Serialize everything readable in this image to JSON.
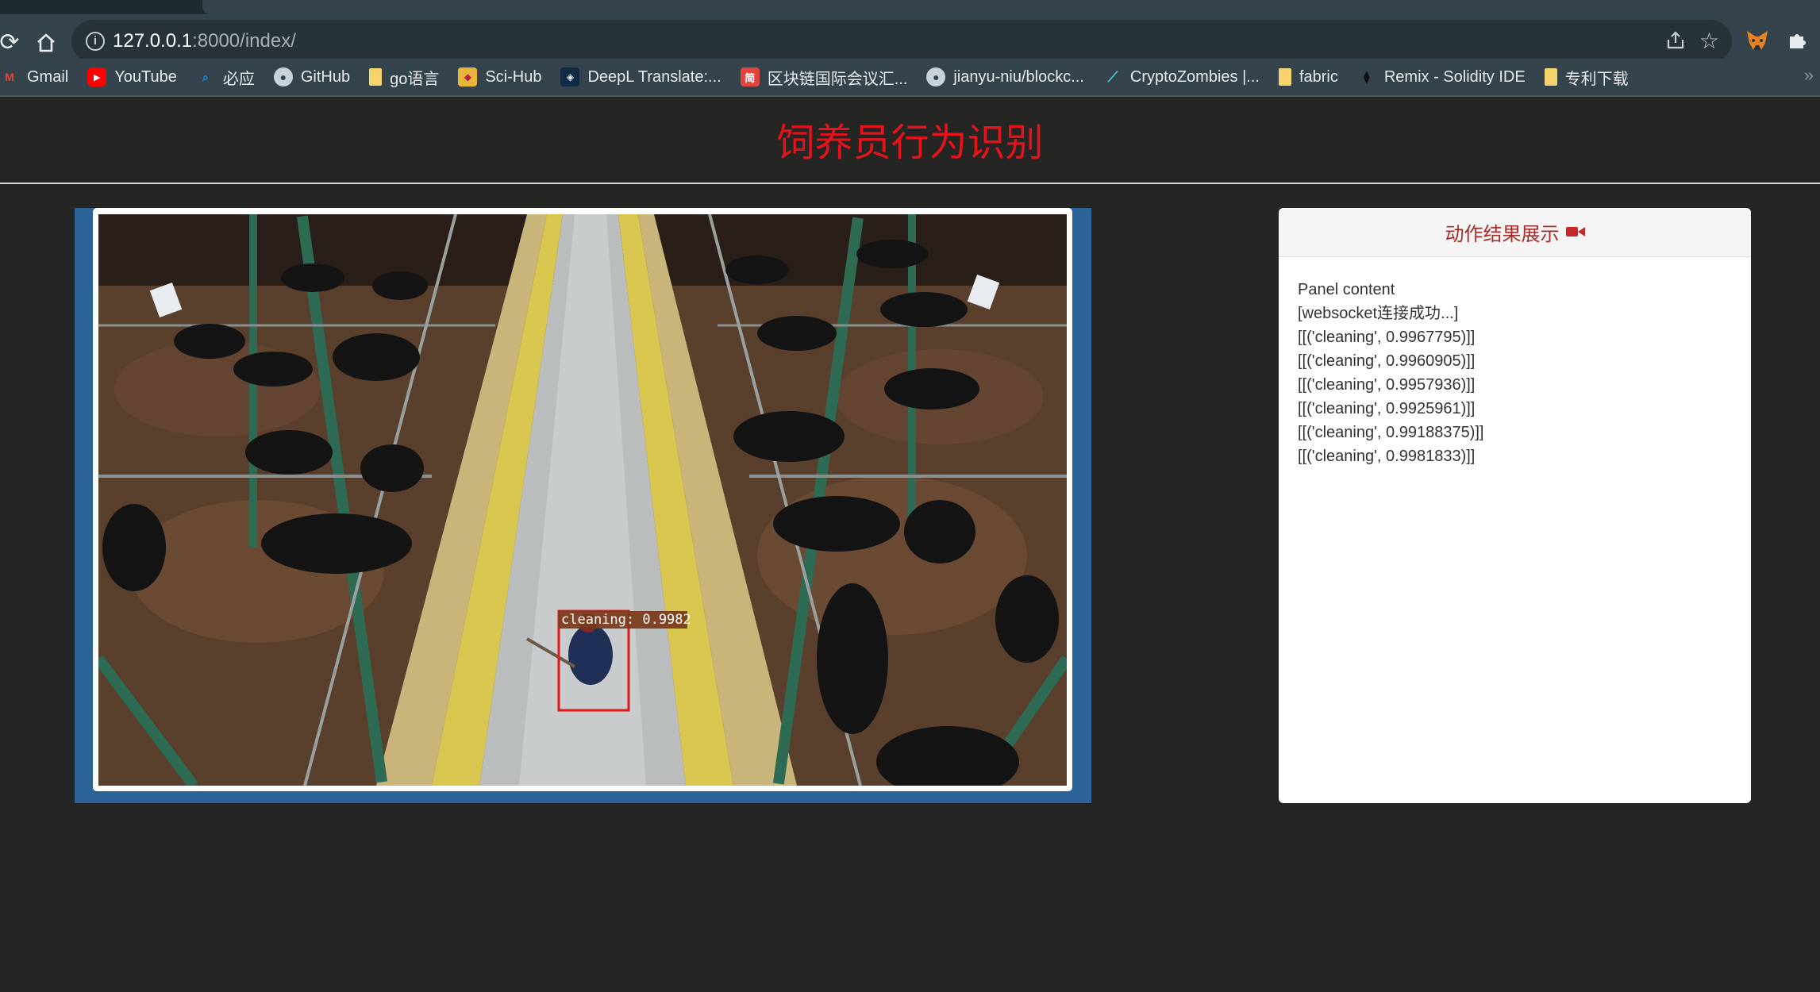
{
  "browser": {
    "url_host": "127.0.0.1",
    "url_path": ":8000/index/",
    "bookmarks": [
      {
        "label": "Gmail",
        "icon": "gmail-icon",
        "color": "#ea4335"
      },
      {
        "label": "YouTube",
        "icon": "youtube-icon",
        "color": "#ff0000"
      },
      {
        "label": "必应",
        "icon": "bing-icon",
        "color": "#1e88e5"
      },
      {
        "label": "GitHub",
        "icon": "github-icon",
        "color": "#c9d1d9"
      },
      {
        "label": "go语言",
        "icon": "folder-icon",
        "color": "#f6d36b"
      },
      {
        "label": "Sci-Hub",
        "icon": "scihub-icon",
        "color": "#e8b53c"
      },
      {
        "label": "DeepL Translate:...",
        "icon": "deepl-icon",
        "color": "#0f2b46"
      },
      {
        "label": "区块链国际会议汇...",
        "icon": "conference-icon",
        "color": "#e0463e"
      },
      {
        "label": "jianyu-niu/blockc...",
        "icon": "github-icon",
        "color": "#c9d1d9"
      },
      {
        "label": "CryptoZombies |...",
        "icon": "cryptozombies-icon",
        "color": "#4fc3d9"
      },
      {
        "label": "fabric",
        "icon": "folder-icon",
        "color": "#f6d36b"
      },
      {
        "label": "Remix - Solidity IDE",
        "icon": "remix-icon",
        "color": "#2a2a2a"
      },
      {
        "label": "专利下载",
        "icon": "folder-icon",
        "color": "#f6d36b"
      }
    ]
  },
  "page": {
    "title": "饲养员行为识别",
    "detection_label": "cleaning: 0.9982"
  },
  "panel": {
    "heading": "动作结果展示",
    "heading_icon": "video-camera-icon",
    "lines": [
      "Panel content",
      "[websocket连接成功...]",
      "[[('cleaning', 0.9967795)]]",
      "[[('cleaning', 0.9960905)]]",
      "[[('cleaning', 0.9957936)]]",
      "[[('cleaning', 0.9925961)]]",
      "[[('cleaning', 0.99188375)]]",
      "[[('cleaning', 0.9981833)]]"
    ]
  },
  "colors": {
    "title_red": "#e5131b",
    "frame_blue": "#2b6399",
    "panel_heading_text": "#a52b2b"
  }
}
